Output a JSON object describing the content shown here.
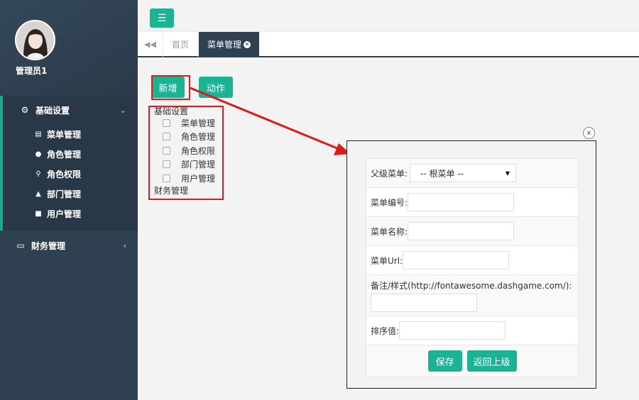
{
  "user": {
    "name": "管理员1"
  },
  "sidebar": {
    "groups": [
      {
        "label": "基础设置",
        "icon": "gear-icon",
        "expanded": true,
        "items": [
          {
            "label": "菜单管理",
            "icon": "list-icon"
          },
          {
            "label": "角色管理",
            "icon": "users-icon"
          },
          {
            "label": "角色权限",
            "icon": "key-icon"
          },
          {
            "label": "部门管理",
            "icon": "sitemap-icon"
          },
          {
            "label": "用户管理",
            "icon": "user-icon"
          }
        ]
      },
      {
        "label": "财务管理",
        "icon": "credit-card-icon",
        "expanded": false,
        "items": []
      }
    ]
  },
  "tabs": {
    "items": [
      {
        "label": "首页"
      },
      {
        "label": "菜单管理",
        "active": true
      }
    ]
  },
  "toolbar": {
    "add_label": "新增",
    "action_label": "动作"
  },
  "tree": {
    "groups": [
      {
        "label": "基础设置",
        "children": [
          "菜单管理",
          "角色管理",
          "角色权限",
          "部门管理",
          "用户管理"
        ]
      },
      {
        "label": "财务管理",
        "children": []
      }
    ]
  },
  "dialog": {
    "fields": {
      "parent_label": "父级菜单:",
      "parent_value": "-- 根菜单 --",
      "code_label": "菜单编号:",
      "code_value": "",
      "name_label": "菜单名称:",
      "name_value": "",
      "url_label": "菜单Url:",
      "url_value": "",
      "remark_label": "备注/样式(http://fontawesome.dashgame.com/):",
      "remark_value": "",
      "order_label": "排序值:",
      "order_value": ""
    },
    "buttons": {
      "save": "保存",
      "back": "返回上级"
    },
    "close_symbol": "x"
  },
  "colors": {
    "sidebar_bg": "#2f4050",
    "accent": "#1ab394",
    "highlight": "#e01818"
  }
}
